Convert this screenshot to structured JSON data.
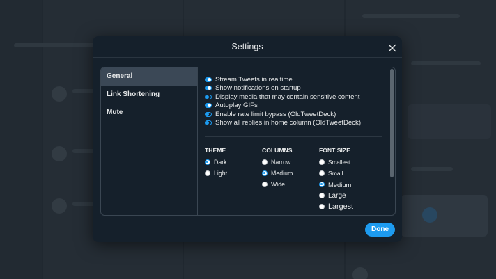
{
  "modal": {
    "title": "Settings",
    "done_label": "Done"
  },
  "nav": {
    "items": [
      {
        "label": "General",
        "active": true
      },
      {
        "label": "Link Shortening",
        "active": false
      },
      {
        "label": "Mute",
        "active": false
      }
    ]
  },
  "general": {
    "toggles": [
      {
        "label": "Stream Tweets in realtime",
        "on": true
      },
      {
        "label": "Show notifications on startup",
        "on": true
      },
      {
        "label": "Display media that may contain sensitive content",
        "on": false
      },
      {
        "label": "Autoplay GIFs",
        "on": true
      },
      {
        "label": "Enable rate limit bypass (OldTweetDeck)",
        "on": false
      },
      {
        "label": "Show all replies in home column (OldTweetDeck)",
        "on": false
      }
    ],
    "theme": {
      "title": "THEME",
      "options": [
        {
          "label": "Dark",
          "selected": true
        },
        {
          "label": "Light",
          "selected": false
        }
      ]
    },
    "columns": {
      "title": "COLUMNS",
      "options": [
        {
          "label": "Narrow",
          "selected": false
        },
        {
          "label": "Medium",
          "selected": true
        },
        {
          "label": "Wide",
          "selected": false
        }
      ]
    },
    "font_size": {
      "title": "FONT SIZE",
      "options": [
        {
          "label": "Smallest",
          "selected": false
        },
        {
          "label": "Small",
          "selected": false
        },
        {
          "label": "Medium",
          "selected": true
        },
        {
          "label": "Large",
          "selected": false
        },
        {
          "label": "Largest",
          "selected": false
        }
      ]
    }
  },
  "colors": {
    "accent": "#1d9bf0",
    "modal_bg": "#15202b",
    "active_nav": "#3b4856"
  }
}
